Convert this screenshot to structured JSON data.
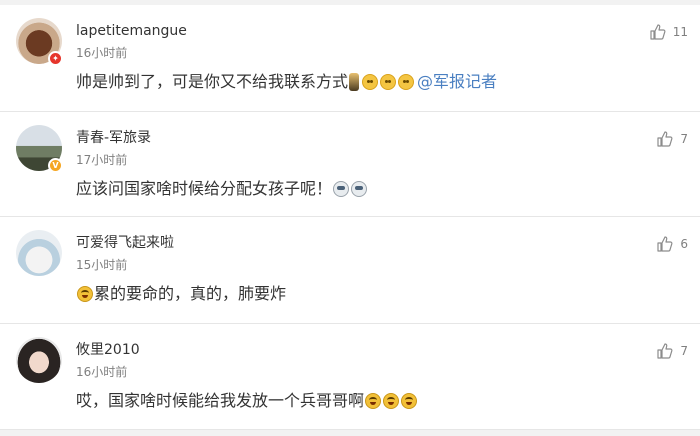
{
  "comments": [
    {
      "username": "lapetitemangue",
      "time": "16小时前",
      "text": "帅是帅到了，可是你又不给我联系方式",
      "mention": "@军报记者",
      "likes": "11",
      "badge": "red",
      "emojis": [
        "figure-icon",
        "smile-emoji-icon",
        "smile-emoji-icon",
        "smile-emoji-icon"
      ]
    },
    {
      "username": "青春-军旅录",
      "time": "17小时前",
      "text": "应该问国家啥时候给分配女孩子呢！",
      "likes": "7",
      "badge": "gold",
      "emojis": [
        "cry-emoji-icon",
        "cry-emoji-icon"
      ]
    },
    {
      "username": "可爱得飞起来啦",
      "time": "15小时前",
      "text": "累的要命的，真的，肺要炸",
      "likes": "6",
      "emojis_prefix": [
        "laugh-cry-emoji-icon"
      ]
    },
    {
      "username": "攸里2010",
      "time": "16小时前",
      "text": "哎，国家啥时候能给我发放一个兵哥哥啊",
      "likes": "7",
      "emojis": [
        "laugh-cry-emoji-icon",
        "laugh-cry-emoji-icon",
        "laugh-cry-emoji-icon"
      ]
    }
  ],
  "colors": {
    "text": "#333333",
    "meta": "#808080",
    "mention": "#4a7fc1",
    "divider": "#e6e6e6",
    "badge_red": "#e6352b",
    "badge_gold": "#f5a623"
  }
}
